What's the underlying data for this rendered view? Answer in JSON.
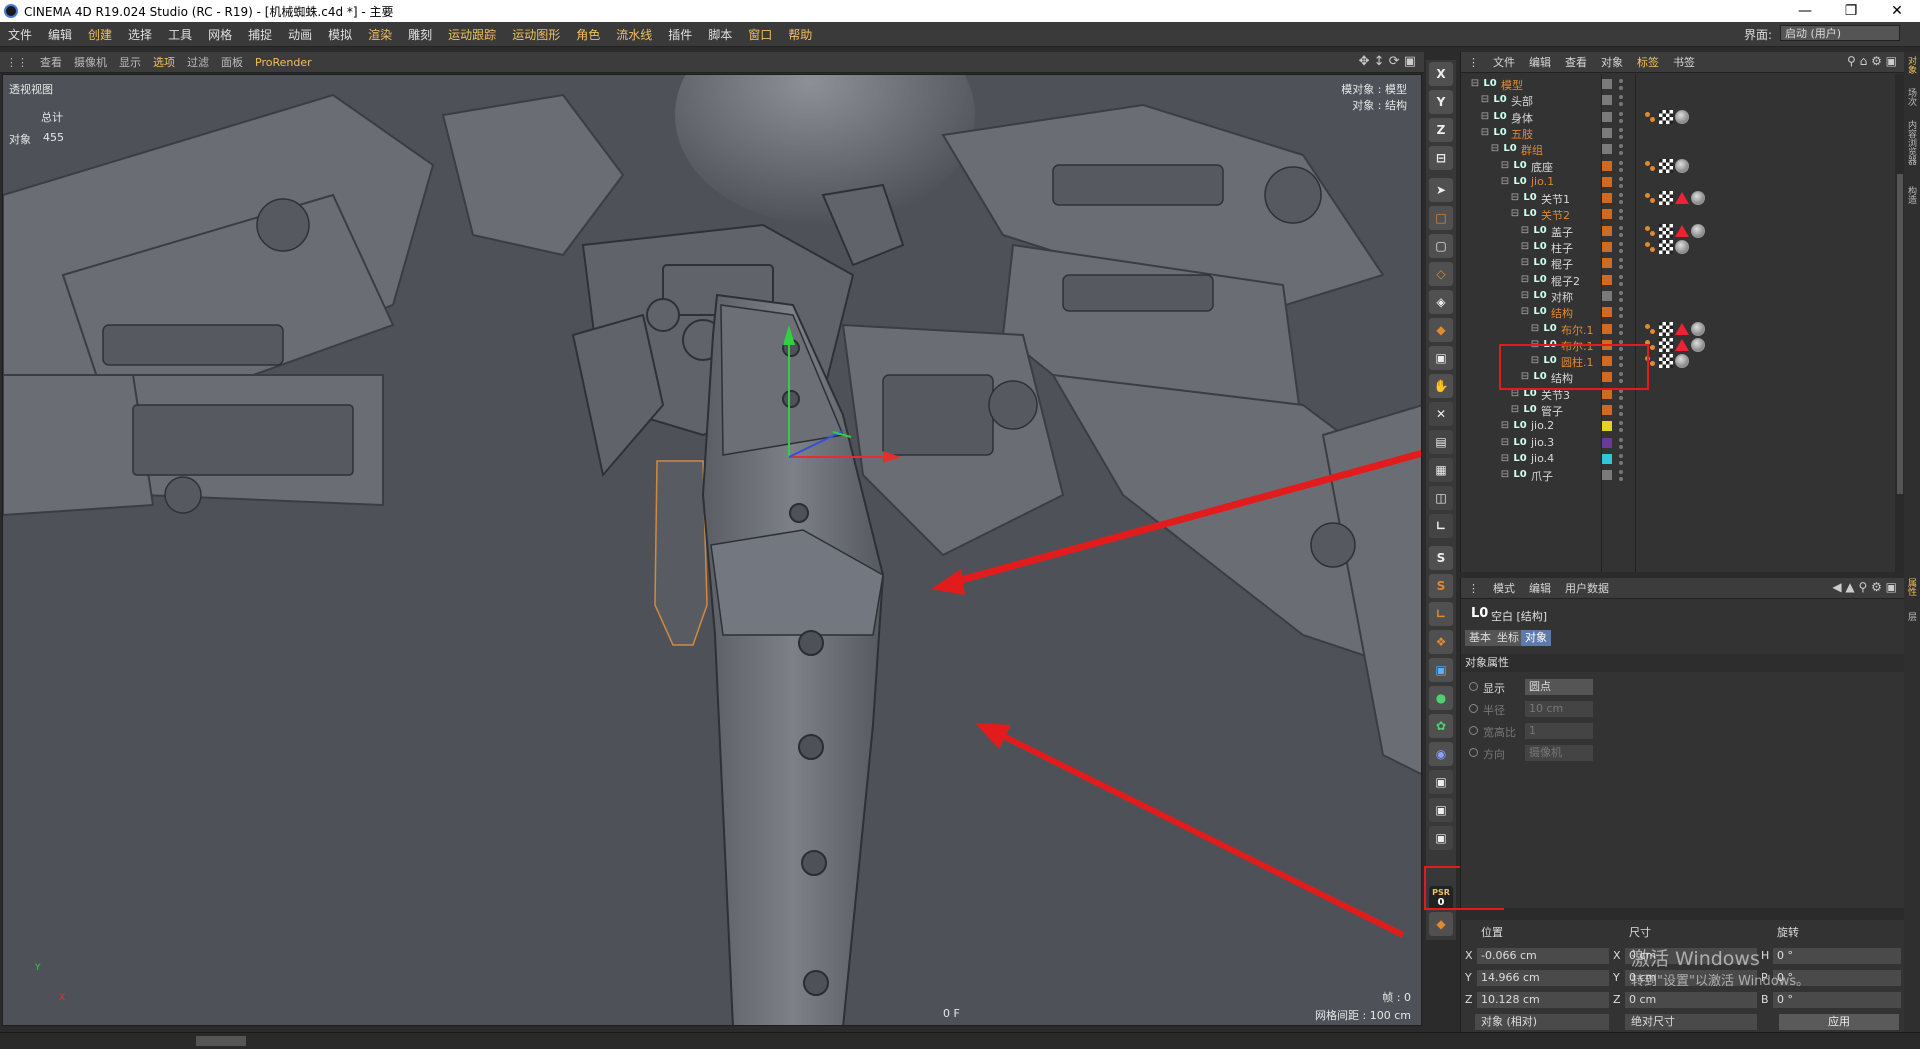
{
  "window": {
    "title": "CINEMA 4D R19.024 Studio (RC - R19) - [机械蜘蛛.c4d *] - 主要"
  },
  "menu": {
    "items": [
      "文件",
      "编辑",
      "创建",
      "选择",
      "工具",
      "网格",
      "捕捉",
      "动画",
      "模拟",
      "渲染",
      "雕刻",
      "运动跟踪",
      "运动图形",
      "角色",
      "流水线",
      "插件",
      "脚本",
      "窗口",
      "帮助"
    ],
    "interface_label": "界面:",
    "interface_value": "启动 (用户)"
  },
  "viewport_toolbar": {
    "items": [
      "查看",
      "摄像机",
      "显示",
      "选项",
      "过滤",
      "面板"
    ],
    "prorender": "ProRender"
  },
  "viewport": {
    "name": "透视视图",
    "stats_header": "总计",
    "stats_label": "对象",
    "stats_value": "455",
    "info_model": "模对象 : 模型",
    "info_object": "对象 : 结构",
    "frame": "帧 : 0",
    "grid": "网格间距 : 100 cm",
    "frame_center": "0 F",
    "axis_y": "Y",
    "axis_x": "X",
    "axis_z": "Z"
  },
  "tools": {
    "x": "X",
    "y": "Y",
    "z": "Z",
    "s1": "S",
    "s2": "S",
    "psr_label": "PSR",
    "psr_value": "0"
  },
  "object_manager": {
    "menu": [
      "文件",
      "编辑",
      "查看",
      "对象",
      "标签",
      "书签"
    ],
    "rows": [
      {
        "label": "模型",
        "indent": 0,
        "color": "#7a7a7a",
        "selected": true,
        "tags": []
      },
      {
        "label": "头部",
        "indent": 1,
        "color": "#7a7a7a",
        "tags": []
      },
      {
        "label": "身体",
        "indent": 1,
        "color": "#7a7a7a",
        "tags": [
          "orange",
          "checker",
          "sphere"
        ]
      },
      {
        "label": "五肢",
        "indent": 1,
        "color": "#7a7a7a",
        "selected": true,
        "tags": []
      },
      {
        "label": "群组",
        "indent": 2,
        "color": "#7a7a7a",
        "selected": true,
        "tags": []
      },
      {
        "label": "底座",
        "indent": 3,
        "color": "#d06a20",
        "tags": [
          "orange",
          "checker",
          "sphere"
        ]
      },
      {
        "label": "jio.1",
        "indent": 3,
        "color": "#d06a20",
        "selected": true,
        "tags": []
      },
      {
        "label": "关节1",
        "indent": 4,
        "color": "#d06a20",
        "tags": [
          "orange",
          "checker",
          "tri",
          "sphere"
        ]
      },
      {
        "label": "关节2",
        "indent": 4,
        "color": "#d06a20",
        "selected": true,
        "tags": []
      },
      {
        "label": "盖子",
        "indent": 5,
        "color": "#d06a20",
        "tags": [
          "orange",
          "checker",
          "tri",
          "sphere"
        ]
      },
      {
        "label": "柱子",
        "indent": 5,
        "color": "#d06a20",
        "tags": [
          "orange",
          "checker",
          "sphere"
        ]
      },
      {
        "label": "棍子",
        "indent": 5,
        "color": "#d06a20",
        "tags": []
      },
      {
        "label": "棍子2",
        "indent": 5,
        "color": "#d06a20",
        "tags": []
      },
      {
        "label": "对称",
        "indent": 5,
        "color": "#7a7a7a",
        "tags": []
      },
      {
        "label": "结构",
        "indent": 5,
        "color": "#d06a20",
        "selected": true,
        "tags": []
      },
      {
        "label": "布尔.1",
        "indent": 6,
        "color": "#d06a20",
        "selected": true,
        "tags": [
          "orange",
          "checker",
          "tri",
          "sphere"
        ]
      },
      {
        "label": "布尔.1",
        "indent": 6,
        "color": "#d06a20",
        "selected": true,
        "tags": [
          "orange",
          "checker",
          "tri",
          "sphere"
        ]
      },
      {
        "label": "圆柱.1",
        "indent": 6,
        "color": "#d06a20",
        "selected": true,
        "tags": [
          "orange",
          "checker",
          "sphere"
        ]
      },
      {
        "label": "结构",
        "indent": 5,
        "color": "#d06a20",
        "tags": []
      },
      {
        "label": "关节3",
        "indent": 4,
        "color": "#d06a20",
        "tags": []
      },
      {
        "label": "管子",
        "indent": 4,
        "color": "#d06a20",
        "tags": []
      },
      {
        "label": "jio.2",
        "indent": 3,
        "color": "#e8d020",
        "tags": []
      },
      {
        "label": "jio.3",
        "indent": 3,
        "color": "#6a3a9a",
        "tags": []
      },
      {
        "label": "jio.4",
        "indent": 3,
        "color": "#30c8d8",
        "tags": []
      },
      {
        "label": "爪子",
        "indent": 3,
        "color": "#7a7a7a",
        "tags": []
      }
    ]
  },
  "attribute_manager": {
    "menu": [
      "模式",
      "编辑",
      "用户数据"
    ],
    "title": "空白 [结构]",
    "tabs": [
      "基本",
      "坐标",
      "对象"
    ],
    "section": "对象属性",
    "fields": [
      {
        "label": "显示",
        "value": "圆点",
        "enabled": true
      },
      {
        "label": "半径",
        "value": "10 cm",
        "enabled": false
      },
      {
        "label": "宽高比",
        "value": "1",
        "enabled": false
      },
      {
        "label": "方向",
        "value": "摄像机",
        "enabled": false
      }
    ]
  },
  "coordinates": {
    "headers": [
      "位置",
      "尺寸",
      "旋转"
    ],
    "rows": [
      {
        "axis": "X",
        "pos": "-0.066 cm",
        "size_axis": "X",
        "size": "0 cm",
        "rot_axis": "H",
        "rot": "0 °"
      },
      {
        "axis": "Y",
        "pos": "14.966 cm",
        "size_axis": "Y",
        "size": "0 cm",
        "rot_axis": "P",
        "rot": "0 °"
      },
      {
        "axis": "Z",
        "pos": "10.128 cm",
        "size_axis": "Z",
        "size": "0 cm",
        "rot_axis": "B",
        "rot": "0 °"
      }
    ],
    "mode_select": "对象 (相对)",
    "size_select": "绝对尺寸",
    "apply": "应用",
    "watermark_line1": "激活 Windows",
    "watermark_line2": "转到\"设置\"以激活 Windows。"
  },
  "right_strip": [
    "对象",
    "场次",
    "内容浏览器",
    "构造",
    "属性",
    "层"
  ]
}
